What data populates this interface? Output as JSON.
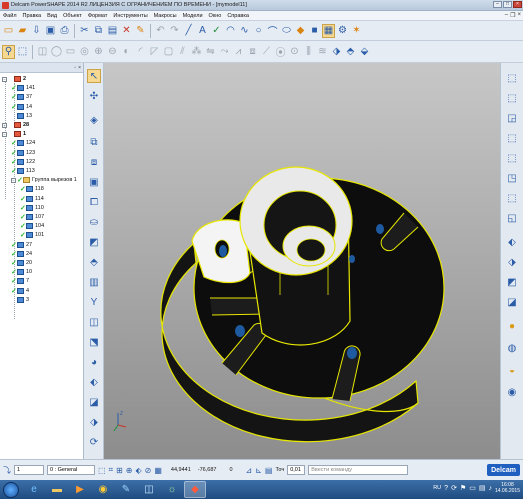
{
  "window": {
    "title": "Delcam PowerSHAPE 2014 R2 ЛИЦЕНЗИЯ С ОГРАНИЧЕНИЕМ ПО ВРЕМЕНИ - [mymodel11]"
  },
  "menu": {
    "items": [
      "Файл",
      "Правка",
      "Вид",
      "Объект",
      "Формат",
      "Инструменты",
      "Макросы",
      "Модели",
      "Окно",
      "Справка"
    ]
  },
  "tree": {
    "items": [
      {
        "label": "2",
        "bold": true,
        "level": 0,
        "icon": "part-icon",
        "expander": "−",
        "check": false
      },
      {
        "label": "141",
        "level": 1,
        "icon": "solid-icon",
        "check": true
      },
      {
        "label": "37",
        "level": 1,
        "icon": "solid-icon",
        "check": true
      },
      {
        "label": "14",
        "level": 1,
        "icon": "solid-icon",
        "check": true
      },
      {
        "label": "13",
        "level": 1,
        "icon": "solid-icon",
        "check": false
      },
      {
        "label": "28",
        "bold": true,
        "level": 0,
        "icon": "part-icon",
        "expander": "+",
        "check": false
      },
      {
        "label": "1",
        "bold": true,
        "level": 0,
        "icon": "part-icon",
        "expander": "−",
        "check": false
      },
      {
        "label": "124",
        "level": 1,
        "icon": "solid-icon",
        "check": true
      },
      {
        "label": "123",
        "level": 1,
        "icon": "solid-icon",
        "check": true
      },
      {
        "label": "122",
        "level": 1,
        "icon": "solid-icon",
        "check": true
      },
      {
        "label": "113",
        "level": 1,
        "icon": "solid-icon",
        "check": true
      },
      {
        "label": "Группа вырезов 1",
        "level": 1,
        "icon": "folder-icon",
        "expander": "−",
        "check": true
      },
      {
        "label": "118",
        "level": 2,
        "icon": "solid-icon",
        "check": true
      },
      {
        "label": "114",
        "level": 2,
        "icon": "solid-icon",
        "check": true
      },
      {
        "label": "110",
        "level": 2,
        "icon": "solid-icon",
        "check": true
      },
      {
        "label": "107",
        "level": 2,
        "icon": "solid-icon",
        "check": true
      },
      {
        "label": "104",
        "level": 2,
        "icon": "solid-icon",
        "check": true
      },
      {
        "label": "101",
        "level": 2,
        "icon": "solid-icon",
        "check": true
      },
      {
        "label": "27",
        "level": 1,
        "icon": "solid-icon",
        "check": true
      },
      {
        "label": "24",
        "level": 1,
        "icon": "solid-icon",
        "check": true
      },
      {
        "label": "20",
        "level": 1,
        "icon": "solid-icon",
        "check": true
      },
      {
        "label": "10",
        "level": 1,
        "icon": "solid-icon",
        "check": true
      },
      {
        "label": "7",
        "level": 1,
        "icon": "solid-icon",
        "check": true
      },
      {
        "label": "4",
        "level": 1,
        "icon": "solid-icon",
        "check": true
      },
      {
        "label": "3",
        "level": 1,
        "icon": "solid-icon",
        "check": false
      }
    ]
  },
  "status": {
    "level_value": "1",
    "layer_value": "0 : General",
    "coord_x": "44,9441",
    "coord_y": "-76,687",
    "coord_z": "0",
    "tolerance_label": "Точ",
    "tolerance_value": "0,01",
    "command_placeholder": "Ввести команду",
    "brand": "Delcam"
  },
  "taskbar": {
    "language": "RU",
    "time": "16:08",
    "date": "14.06.2015"
  },
  "colors": {
    "viewport_top": "#c7c7c7",
    "viewport_bottom": "#8d8d8d",
    "selection_edge": "#e6e600",
    "accent": "#2a5ca8"
  }
}
